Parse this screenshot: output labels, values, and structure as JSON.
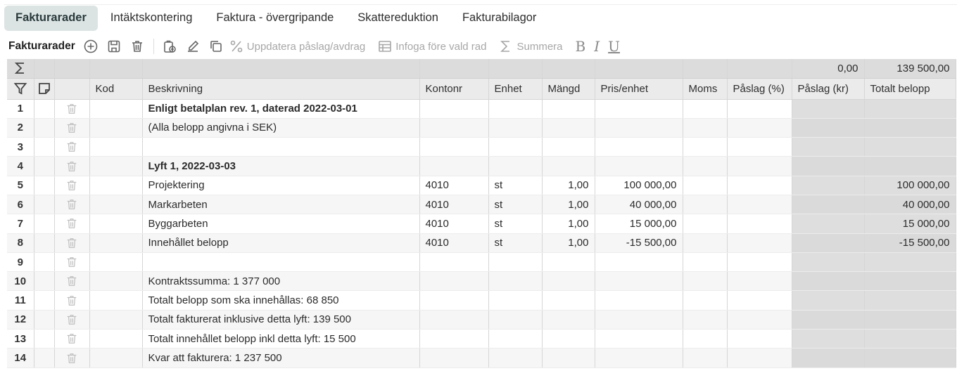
{
  "tabs": [
    {
      "label": "Fakturarader",
      "active": true
    },
    {
      "label": "Intäktskontering"
    },
    {
      "label": "Faktura - övergripande"
    },
    {
      "label": "Skattereduktion"
    },
    {
      "label": "Fakturabilagor"
    }
  ],
  "toolbar": {
    "title": "Fakturarader",
    "update_markup": "Uppdatera påslag/avdrag",
    "insert_before": "Infoga före vald rad",
    "summarize": "Summera",
    "bold": "B",
    "italic": "I",
    "underline": "U"
  },
  "summary": {
    "markup_kr": "0,00",
    "total": "139 500,00"
  },
  "columns": {
    "code": "Kod",
    "description": "Beskrivning",
    "account": "Kontonr",
    "unit": "Enhet",
    "quantity": "Mängd",
    "unit_price": "Pris/enhet",
    "vat": "Moms",
    "markup_pct": "Påslag (%)",
    "markup_kr": "Påslag (kr)",
    "total": "Totalt belopp"
  },
  "rows": [
    {
      "n": "1",
      "description": "Enligt betalplan rev. 1, daterad 2022-03-01",
      "bold": true,
      "account": "",
      "unit": "",
      "quantity": "",
      "price": "",
      "total": ""
    },
    {
      "n": "2",
      "description": "(Alla belopp angivna i SEK)",
      "bold": false,
      "account": "",
      "unit": "",
      "quantity": "",
      "price": "",
      "total": ""
    },
    {
      "n": "3",
      "description": "",
      "bold": false,
      "account": "",
      "unit": "",
      "quantity": "",
      "price": "",
      "total": ""
    },
    {
      "n": "4",
      "description": "Lyft 1, 2022-03-03",
      "bold": true,
      "account": "",
      "unit": "",
      "quantity": "",
      "price": "",
      "total": ""
    },
    {
      "n": "5",
      "description": "Projektering",
      "bold": false,
      "account": "4010",
      "unit": "st",
      "quantity": "1,00",
      "price": "100 000,00",
      "total": "100 000,00"
    },
    {
      "n": "6",
      "description": "Markarbeten",
      "bold": false,
      "account": "4010",
      "unit": "st",
      "quantity": "1,00",
      "price": "40 000,00",
      "total": "40 000,00"
    },
    {
      "n": "7",
      "description": "Byggarbeten",
      "bold": false,
      "account": "4010",
      "unit": "st",
      "quantity": "1,00",
      "price": "15 000,00",
      "total": "15 000,00"
    },
    {
      "n": "8",
      "description": "Innehållet belopp",
      "bold": false,
      "account": "4010",
      "unit": "st",
      "quantity": "1,00",
      "price": "-15 500,00",
      "total": "-15 500,00"
    },
    {
      "n": "9",
      "description": "",
      "bold": false,
      "account": "",
      "unit": "",
      "quantity": "",
      "price": "",
      "total": ""
    },
    {
      "n": "10",
      "description": "Kontraktssumma: 1 377 000",
      "bold": false,
      "account": "",
      "unit": "",
      "quantity": "",
      "price": "",
      "total": ""
    },
    {
      "n": "11",
      "description": "Totalt belopp som ska innehållas: 68 850",
      "bold": false,
      "account": "",
      "unit": "",
      "quantity": "",
      "price": "",
      "total": ""
    },
    {
      "n": "12",
      "description": "Totalt fakturerat inklusive detta lyft: 139 500",
      "bold": false,
      "account": "",
      "unit": "",
      "quantity": "",
      "price": "",
      "total": ""
    },
    {
      "n": "13",
      "description": "Totalt innehållet belopp inkl detta lyft: 15 500",
      "bold": false,
      "account": "",
      "unit": "",
      "quantity": "",
      "price": "",
      "total": ""
    },
    {
      "n": "14",
      "description": "Kvar att fakturera: 1 237 500",
      "bold": false,
      "account": "",
      "unit": "",
      "quantity": "",
      "price": "",
      "total": ""
    }
  ]
}
